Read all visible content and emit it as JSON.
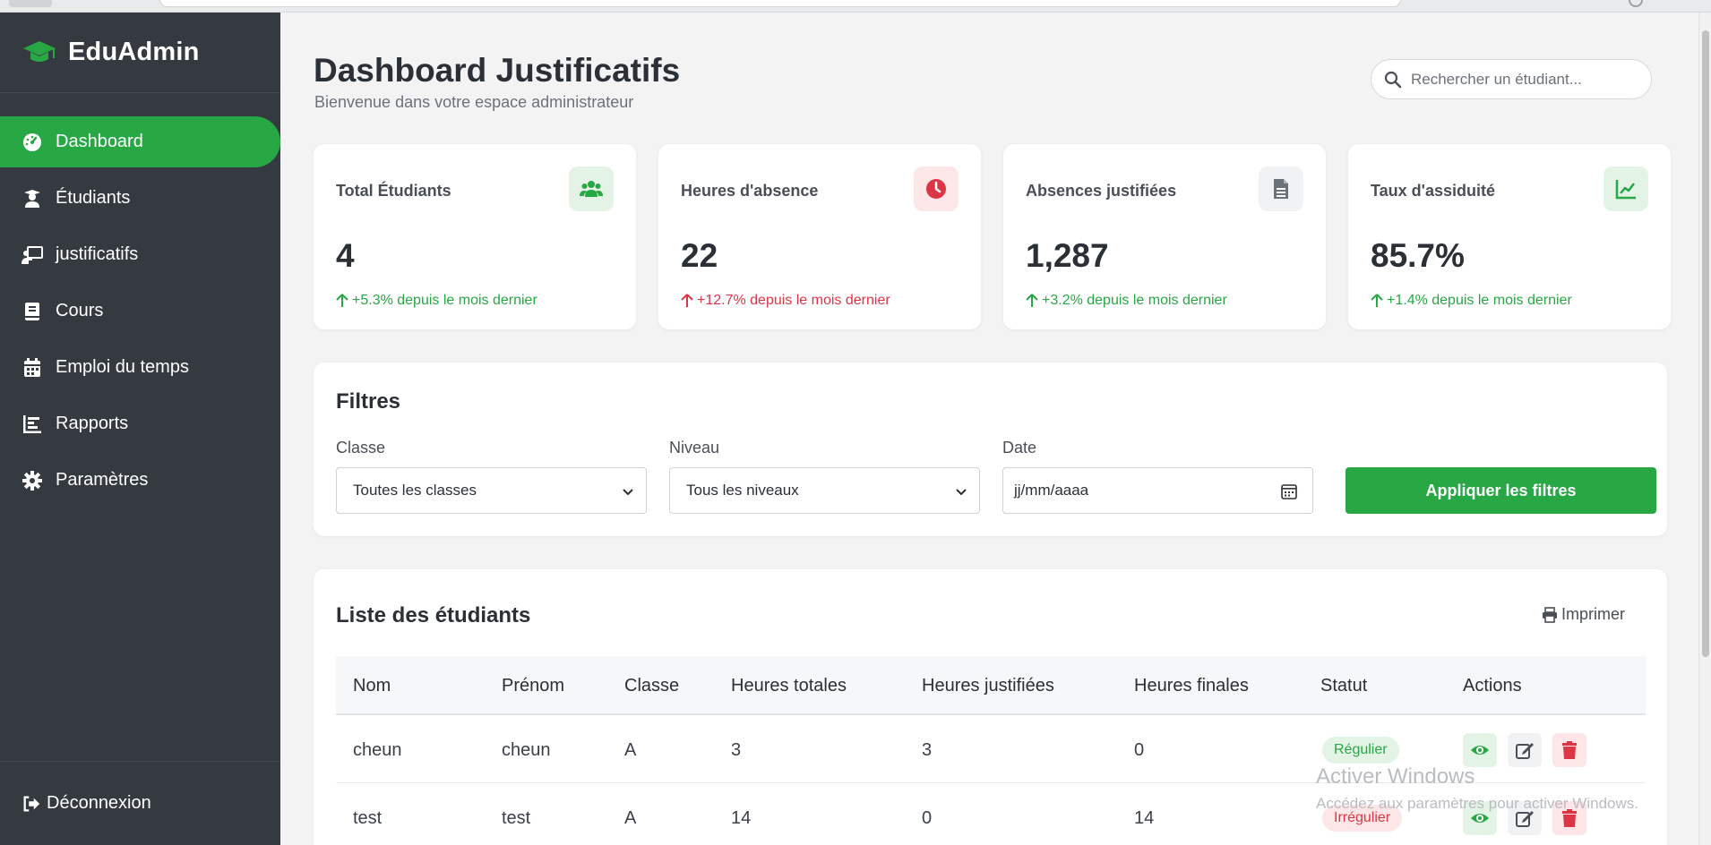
{
  "brand": {
    "name": "EduAdmin",
    "icon": "graduation-cap-icon",
    "accent": "#28a745"
  },
  "sidebar": {
    "items": [
      {
        "label": "Dashboard",
        "icon": "dashboard-gauge-icon",
        "active": true
      },
      {
        "label": "Étudiants",
        "icon": "student-icon",
        "active": false
      },
      {
        "label": "justificatifs",
        "icon": "teacher-board-icon",
        "active": false
      },
      {
        "label": "Cours",
        "icon": "book-icon",
        "active": false
      },
      {
        "label": "Emploi du temps",
        "icon": "calendar-icon",
        "active": false
      },
      {
        "label": "Rapports",
        "icon": "bar-chart-icon",
        "active": false
      },
      {
        "label": "Paramètres",
        "icon": "gear-icon",
        "active": false
      }
    ],
    "logout_label": "Déconnexion"
  },
  "header": {
    "title": "Dashboard Justificatifs",
    "subtitle": "Bienvenue dans votre espace administrateur",
    "search_placeholder": "Rechercher un étudiant..."
  },
  "stats": [
    {
      "title": "Total Étudiants",
      "value": "4",
      "trend": "+5.3% depuis le mois dernier",
      "trend_color": "#28a745",
      "icon": "users-icon",
      "icon_color": "#28a745",
      "icon_bg": "#e3f4e6"
    },
    {
      "title": "Heures d'absence",
      "value": "22",
      "trend": "+12.7% depuis le mois dernier",
      "trend_color": "#dc3545",
      "icon": "clock-icon",
      "icon_color": "#dc3545",
      "icon_bg": "#fde6e8"
    },
    {
      "title": "Absences justifiées",
      "value": "1,287",
      "trend": "+3.2% depuis le mois dernier",
      "trend_color": "#28a745",
      "icon": "file-icon",
      "icon_color": "#6c727a",
      "icon_bg": "#f1f2f3"
    },
    {
      "title": "Taux d'assiduité",
      "value": "85.7%",
      "trend": "+1.4% depuis le mois dernier",
      "trend_color": "#28a745",
      "icon": "line-chart-icon",
      "icon_color": "#28a745",
      "icon_bg": "#e3f4e6"
    }
  ],
  "filters": {
    "title": "Filtres",
    "classe_label": "Classe",
    "classe_value": "Toutes les classes",
    "niveau_label": "Niveau",
    "niveau_value": "Tous les niveaux",
    "date_label": "Date",
    "date_placeholder": "jj/mm/aaaa",
    "apply_label": "Appliquer les filtres"
  },
  "students": {
    "title": "Liste des étudiants",
    "print_label": "Imprimer",
    "columns": [
      "Nom",
      "Prénom",
      "Classe",
      "Heures totales",
      "Heures justifiées",
      "Heures finales",
      "Statut",
      "Actions"
    ],
    "rows": [
      {
        "nom": "cheun",
        "prenom": "cheun",
        "classe": "A",
        "totales": "3",
        "justifiees": "3",
        "finales": "0",
        "statut": "Régulier",
        "statut_type": "ok"
      },
      {
        "nom": "test",
        "prenom": "test",
        "classe": "A",
        "totales": "14",
        "justifiees": "0",
        "finales": "14",
        "statut": "Irrégulier",
        "statut_type": "bad"
      }
    ]
  },
  "watermark": {
    "line1": "Activer Windows",
    "line2": "Accédez aux paramètres pour activer Windows."
  }
}
